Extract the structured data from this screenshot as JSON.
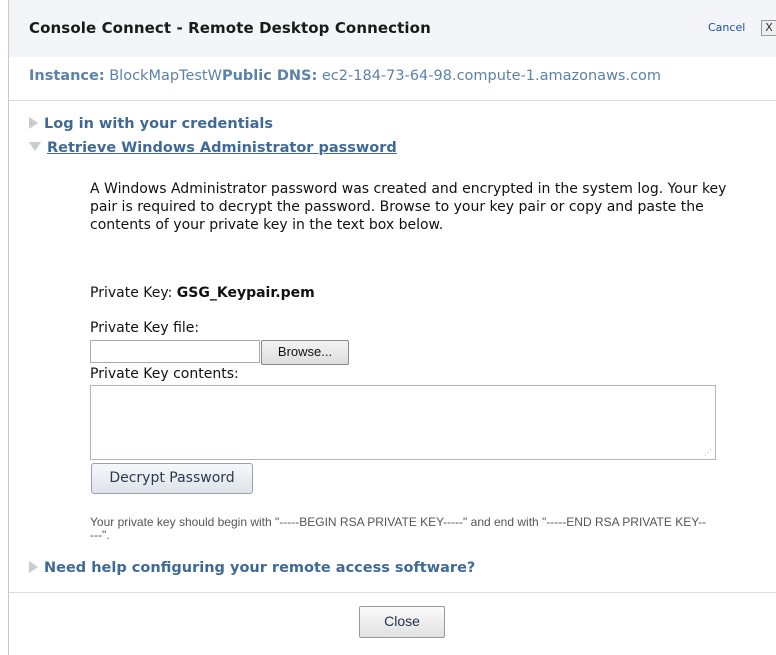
{
  "dialog": {
    "title": "Console Connect - Remote Desktop Connection",
    "cancel_label": "Cancel",
    "cancel_x": "X"
  },
  "info": {
    "instance_label": "Instance:",
    "instance_value": "BlockMapTestW",
    "dns_label": "Public DNS:",
    "dns_value": "ec2-184-73-64-98.compute-1.amazonaws.com"
  },
  "sections": {
    "login": "Log in with your credentials",
    "retrieve": "Retrieve Windows Administrator password",
    "help": "Need help configuring your remote access software?"
  },
  "retrieve": {
    "description": "A Windows Administrator password was created and encrypted in the system log. Your key pair is required to decrypt the password. Browse to your key pair or copy and paste the contents of your private key in the text box below.",
    "private_key_label": "Private Key:",
    "private_key_value": "GSG_Keypair.pem",
    "file_label": "Private Key file:",
    "file_value": "",
    "browse_label": "Browse...",
    "contents_label": "Private Key contents:",
    "contents_value": "",
    "decrypt_label": "Decrypt Password",
    "hint": "Your private key should begin with \"-----BEGIN RSA PRIVATE KEY-----\" and end with \"-----END RSA PRIVATE KEY-----\"."
  },
  "footer": {
    "close_label": "Close"
  }
}
